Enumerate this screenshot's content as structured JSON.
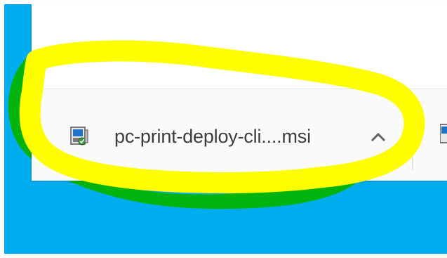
{
  "download_shelf": {
    "item": {
      "filename": "pc-print-deploy-cli....msi",
      "icon": "msi-installer-icon",
      "menu_icon": "chevron-up-icon"
    },
    "next_item_icon": "msi-installer-icon"
  },
  "annotation": {
    "highlight_color": "#ffff00",
    "outline_color": "#00b400"
  },
  "desktop": {
    "background_color": "#00adef"
  }
}
